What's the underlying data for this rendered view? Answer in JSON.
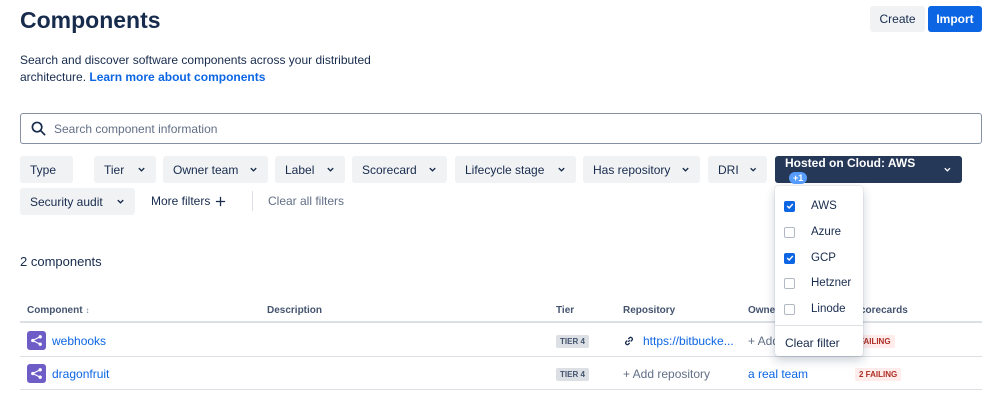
{
  "page": {
    "title": "Components",
    "create_label": "Create",
    "import_label": "Import",
    "description": "Search and discover software components across your distributed architecture.",
    "learn_more": "Learn more about components"
  },
  "search": {
    "placeholder": "Search component information"
  },
  "filters": [
    {
      "label": "Type"
    },
    {
      "label": "Tier"
    },
    {
      "label": "Owner team"
    },
    {
      "label": "Label"
    },
    {
      "label": "Scorecard"
    },
    {
      "label": "Lifecycle stage"
    },
    {
      "label": "Has repository"
    },
    {
      "label": "DRI"
    },
    {
      "label": "Hosted on Cloud: AWS",
      "badge": "+1"
    },
    {
      "label": "Security audit"
    }
  ],
  "more_filters": "More filters",
  "clear_all": "Clear all filters",
  "count": "2 components",
  "table": {
    "headers": [
      "Component",
      "Description",
      "Tier",
      "Repository",
      "Owne",
      "corecards"
    ],
    "rows": [
      {
        "name": "webhooks",
        "tier": "TIER 4",
        "repository": "https://bitbucke...",
        "owner": "+ Add",
        "scorecard": "FAILING"
      },
      {
        "name": "dragonfruit",
        "tier": "TIER 4",
        "repository": "+ Add repository",
        "owner": "a real team",
        "scorecard": "2 FAILING"
      }
    ]
  },
  "dropdown": {
    "options": [
      {
        "label": "AWS",
        "checked": true
      },
      {
        "label": "Azure",
        "checked": false
      },
      {
        "label": "GCP",
        "checked": true
      },
      {
        "label": "Hetzner",
        "checked": false
      },
      {
        "label": "Linode",
        "checked": false
      }
    ],
    "clear_label": "Clear filter"
  },
  "colors": {
    "accent": "#0c66e4",
    "active_chip": "#253858",
    "component_icon": "#6e5dc6",
    "failing": "#ae2e24"
  }
}
